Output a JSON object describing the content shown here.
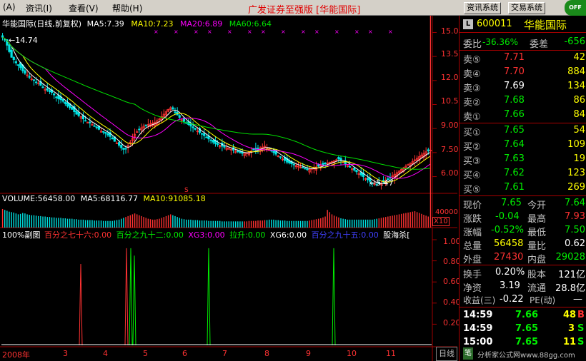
{
  "menu": {
    "items": [
      "(A)",
      "资讯(I)",
      "查看(V)",
      "帮助(H)"
    ]
  },
  "app_title": "广发证券至强版 [华能国际]",
  "sys_buttons": [
    "资讯系统",
    "交易系统"
  ],
  "corner_badge": "OFF",
  "chart": {
    "title": "华能国际(日线,前复权)",
    "ma_labels": [
      "MA5:7.39",
      "MA10:7.23",
      "MA20:6.89",
      "MA60:6.64"
    ],
    "high_note": "14.74",
    "low_note": "5.47",
    "price_axis": [
      "15.00",
      "13.50",
      "12.00",
      "10.50",
      "9.00",
      "7.50",
      "6.00"
    ],
    "volume_labels": [
      "VOLUME:56458.00",
      "MA5:68116.77",
      "MA10:91085.18"
    ],
    "volume_axis": "40000",
    "volume_scale": "X10",
    "ind_labels": [
      "100%副图",
      "百分之七十六:0.00",
      "百分之九十二:0.00",
      "XG3:0.00",
      "拉升:0.00",
      "XG6:0.00",
      "百分之九十五:0.00",
      "股海杀["
    ],
    "ind_axis": [
      "1.00",
      "0.80",
      "0.60",
      "0.40",
      "0.20"
    ],
    "date_labels": [
      "2008年",
      "3",
      "4",
      "5",
      "6",
      "7",
      "8",
      "9",
      "10",
      "11"
    ],
    "period_tab": "日线",
    "closes": [
      14.7,
      14.55,
      14.2,
      13.8,
      13.45,
      13.3,
      13.1,
      12.95,
      12.8,
      12.6,
      12.45,
      12.35,
      12.2,
      12.1,
      12.0,
      11.9,
      11.85,
      11.7,
      11.55,
      11.45,
      11.4,
      11.3,
      11.25,
      11.1,
      10.95,
      10.85,
      10.8,
      10.7,
      10.55,
      10.4,
      10.3,
      10.2,
      10.05,
      9.9,
      9.8,
      9.75,
      9.6,
      9.5,
      9.4,
      9.35,
      9.25,
      9.15,
      9.05,
      8.95,
      8.85,
      8.8,
      8.7,
      8.6,
      8.5,
      8.35,
      8.2,
      8.1,
      7.95,
      7.8,
      7.7,
      7.75,
      7.95,
      8.15,
      8.4,
      8.65,
      8.8,
      8.95,
      9.05,
      9.15,
      9.2,
      9.25,
      9.3,
      9.35,
      9.4,
      9.5,
      9.6,
      9.75,
      9.9,
      10.05,
      10.2,
      10.3,
      10.2,
      10.0,
      9.85,
      9.7,
      9.55,
      9.45,
      9.35,
      9.25,
      9.15,
      9.05,
      8.95,
      8.85,
      8.75,
      8.65,
      8.55,
      8.45,
      8.35,
      8.25,
      8.15,
      8.05,
      8.0,
      7.95,
      7.9,
      7.85,
      7.8,
      7.75,
      7.7,
      7.65,
      7.6,
      7.55,
      7.5,
      7.45,
      7.45,
      7.5,
      7.55,
      7.6,
      7.65,
      7.7,
      7.75,
      7.8,
      7.85,
      7.9,
      7.8,
      7.7,
      7.6,
      7.5,
      7.4,
      7.3,
      7.2,
      7.1,
      7.0,
      6.9,
      6.85,
      6.8,
      6.75,
      6.7,
      6.65,
      6.6,
      6.55,
      6.5,
      6.45,
      6.45,
      6.5,
      6.55,
      6.6,
      6.65,
      6.7,
      6.75,
      6.8,
      6.85,
      6.9,
      6.95,
      7.0,
      7.05,
      7.1,
      7.0,
      6.9,
      6.8,
      6.7,
      6.6,
      6.5,
      6.4,
      6.3,
      6.2,
      6.1,
      6.0,
      5.9,
      5.8,
      5.7,
      5.6,
      5.55,
      5.5,
      5.55,
      5.6,
      5.65,
      5.75,
      5.85,
      5.95,
      6.05,
      6.15,
      6.25,
      6.35,
      6.45,
      6.55,
      6.65,
      6.75,
      6.85,
      6.95,
      7.05,
      7.15,
      7.25,
      7.35,
      7.45,
      7.55,
      7.6,
      7.65
    ],
    "volumes": [
      4.2,
      4.0,
      3.8,
      3.6,
      3.5,
      3.4,
      3.2,
      3.0,
      3.1,
      3.3,
      3.2,
      3.0,
      2.9,
      2.8,
      2.8,
      2.7,
      2.6,
      2.6,
      2.5,
      2.5,
      2.4,
      2.4,
      2.3,
      2.3,
      2.2,
      2.2,
      2.2,
      2.1,
      2.1,
      2.0,
      2.0,
      2.0,
      1.9,
      1.9,
      1.8,
      1.8,
      1.8,
      1.7,
      1.7,
      1.7,
      1.7,
      1.6,
      1.6,
      1.6,
      1.6,
      1.5,
      1.5,
      1.5,
      1.5,
      1.5,
      1.6,
      1.7,
      1.8,
      2.0,
      2.2,
      2.4,
      2.6,
      2.8,
      3.0,
      3.2,
      3.0,
      2.8,
      2.6,
      2.4,
      2.2,
      2.0,
      1.9,
      1.8,
      1.8,
      1.9,
      2.0,
      2.2,
      2.4,
      2.6,
      2.8,
      3.0,
      2.8,
      2.6,
      2.4,
      2.2,
      2.0,
      1.9,
      1.8,
      1.8,
      1.8,
      1.7,
      1.7,
      1.7,
      1.6,
      1.6,
      1.6,
      1.6,
      1.5,
      1.5,
      1.5,
      1.5,
      1.5,
      1.5,
      1.4,
      1.4,
      1.4,
      1.4,
      1.4,
      1.4,
      1.4,
      1.4,
      1.4,
      1.4,
      1.4,
      1.4,
      1.5,
      1.5,
      1.5,
      1.5,
      1.6,
      1.6,
      1.6,
      1.7,
      1.7,
      1.8,
      1.8,
      1.8,
      1.7,
      1.7,
      1.6,
      1.6,
      1.6,
      1.5,
      1.5,
      1.5,
      1.5,
      1.5,
      1.5,
      1.5,
      1.5,
      1.5,
      1.5,
      1.6,
      1.7,
      1.8,
      1.9,
      2.0,
      2.1,
      2.3,
      2.5,
      4.0,
      3.5,
      3.0,
      2.7,
      2.5,
      2.3,
      2.1,
      2.0,
      1.9,
      1.8,
      1.8,
      1.8,
      1.8,
      1.8,
      1.8,
      1.8,
      1.8,
      1.8,
      1.8,
      1.8,
      1.8,
      1.9,
      2.0,
      2.1,
      2.2,
      2.3,
      2.4,
      2.5,
      2.6,
      2.7,
      2.8,
      2.9,
      3.0,
      3.1,
      3.2,
      3.3,
      3.4,
      3.5,
      3.6,
      3.7,
      3.5,
      3.3,
      3.1,
      2.9,
      2.7,
      2.5
    ]
  },
  "quote": {
    "code": "600011",
    "name": "华能国际",
    "weibi_label": "委比",
    "weibi_value": "-36.36%",
    "weicha_label": "委差",
    "weicha_value": "-656",
    "asks": [
      {
        "label": "卖⑤",
        "price": "7.71",
        "vol": "42"
      },
      {
        "label": "卖④",
        "price": "7.70",
        "vol": "884"
      },
      {
        "label": "卖③",
        "price": "7.69",
        "vol": "134"
      },
      {
        "label": "卖②",
        "price": "7.68",
        "vol": "86"
      },
      {
        "label": "卖①",
        "price": "7.66",
        "vol": "84"
      }
    ],
    "bids": [
      {
        "label": "买①",
        "price": "7.65",
        "vol": "54"
      },
      {
        "label": "买②",
        "price": "7.64",
        "vol": "109"
      },
      {
        "label": "买③",
        "price": "7.63",
        "vol": "19"
      },
      {
        "label": "买④",
        "price": "7.62",
        "vol": "123"
      },
      {
        "label": "买⑤",
        "price": "7.61",
        "vol": "269"
      }
    ],
    "stats": [
      {
        "l1": "现价",
        "v1": "7.65",
        "l2": "今开",
        "v2": "7.64"
      },
      {
        "l1": "涨跌",
        "v1": "-0.04",
        "l2": "最高",
        "v2": "7.93"
      },
      {
        "l1": "涨幅",
        "v1": "-0.52%",
        "l2": "最低",
        "v2": "7.50"
      },
      {
        "l1": "总量",
        "v1": "56458",
        "l2": "量比",
        "v2": "0.62"
      },
      {
        "l1": "外盘",
        "v1": "27430",
        "l2": "内盘",
        "v2": "29028"
      }
    ],
    "fundamentals": [
      {
        "l1": "换手",
        "v1": "0.20%",
        "l2": "股本",
        "v2": "121亿"
      },
      {
        "l1": "净资",
        "v1": "3.19",
        "l2": "流通",
        "v2": "28.8亿"
      },
      {
        "l1": "收益(三)",
        "v1": "-0.22",
        "l2": "PE(动)",
        "v2": "—"
      }
    ],
    "ticks": [
      {
        "time": "14:59",
        "price": "7.66",
        "vol": "48",
        "side": "B"
      },
      {
        "time": "14:59",
        "price": "7.65",
        "vol": "3",
        "side": "S"
      },
      {
        "time": "15:00",
        "price": "7.65",
        "vol": "11",
        "side": "S"
      }
    ]
  },
  "watermark": "分析家公式网www.88gg.com",
  "colors": {
    "up": "#ff3232",
    "down": "#00e5e5",
    "ma5": "#ffffff",
    "ma10": "#ffff00",
    "ma20": "#ff00ff",
    "ma60": "#00e000",
    "grid": "#a00000",
    "ind_red": "#ff3232",
    "ind_green": "#00ee00"
  }
}
